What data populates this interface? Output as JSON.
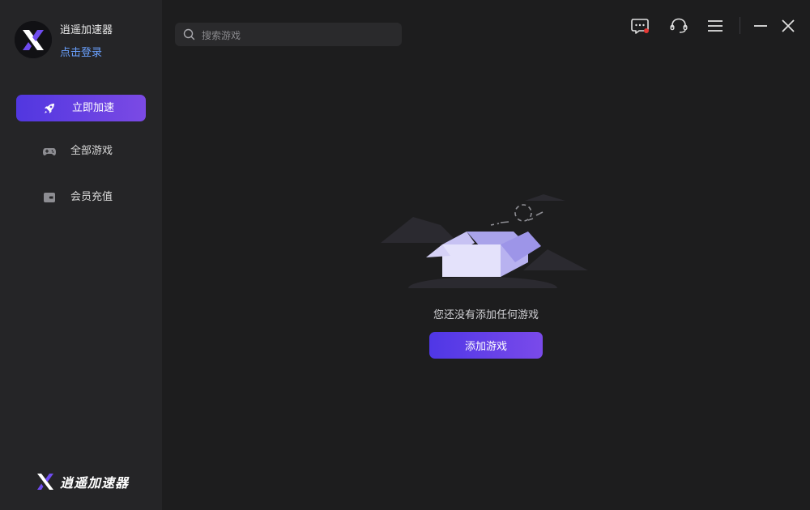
{
  "app": {
    "name": "逍遥加速器",
    "login_label": "点击登录"
  },
  "sidebar": {
    "items": [
      {
        "label": "立即加速",
        "icon": "rocket-icon",
        "active": true
      },
      {
        "label": "全部游戏",
        "icon": "gamepad-icon",
        "active": false
      },
      {
        "label": "会员充值",
        "icon": "wallet-icon",
        "active": false
      }
    ],
    "footer_brand": "逍遥加速器"
  },
  "search": {
    "placeholder": "搜索游戏",
    "value": ""
  },
  "toolbar": {
    "icons": [
      "message-icon",
      "headset-icon",
      "menu-icon",
      "minimize-icon",
      "close-icon"
    ]
  },
  "empty_state": {
    "message": "您还没有添加任何游戏",
    "button_label": "添加游戏"
  },
  "colors": {
    "accent_start": "#5137e0",
    "accent_end": "#7b4ae4",
    "link": "#6aa1ff",
    "background": "#1d1d1e",
    "sidebar": "#252527",
    "notification_dot": "#e53935"
  }
}
